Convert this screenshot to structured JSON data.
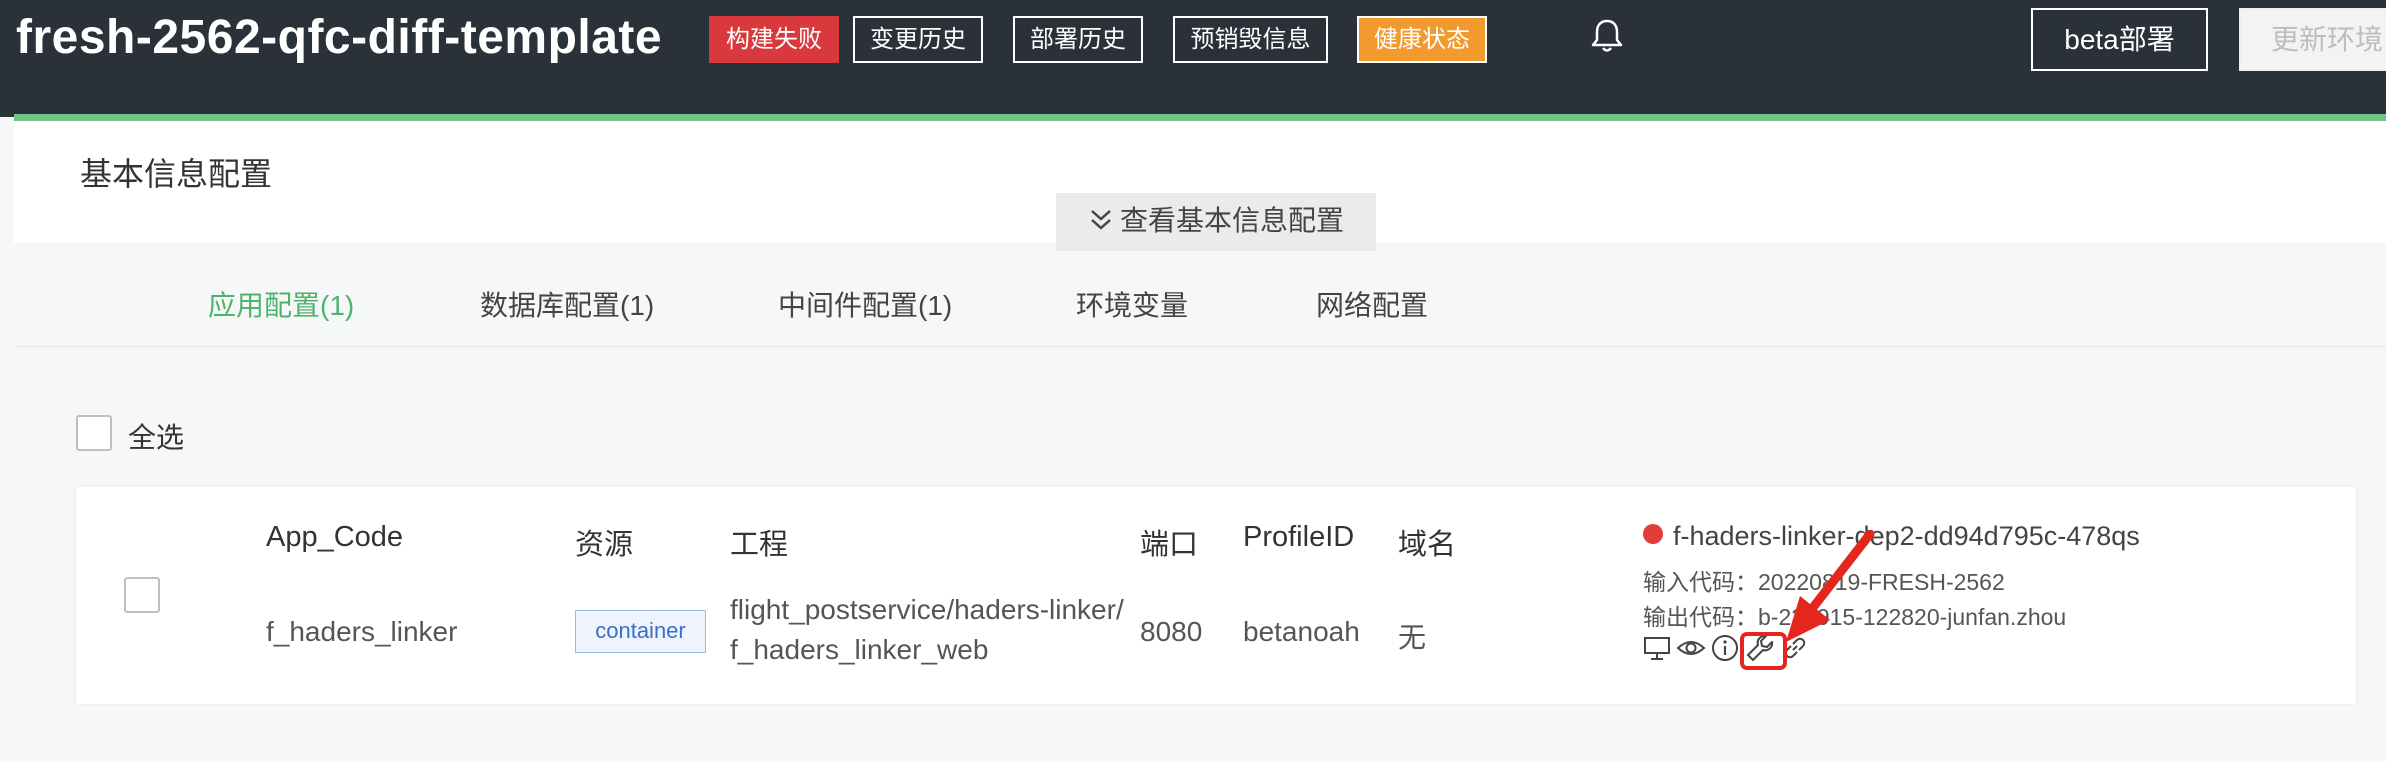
{
  "header": {
    "title": "fresh-2562-qfc-diff-template",
    "badges": {
      "build_failed": "构建失败",
      "change_history": "变更历史",
      "deploy_history": "部署历史",
      "predestroy_info": "预销毁信息",
      "health_status": "健康状态"
    },
    "bell_icon": "bell-icon",
    "beta_deploy": "beta部署",
    "update_env": "更新环境"
  },
  "basic_info": {
    "label": "基本信息配置",
    "toggle_label": "查看基本信息配置"
  },
  "tabs": [
    "应用配置(1)",
    "数据库配置(1)",
    "中间件配置(1)",
    "环境变量",
    "网络配置"
  ],
  "select_all_label": "全选",
  "table": {
    "headers": {
      "app_code": "App_Code",
      "resource": "资源",
      "project": "工程",
      "port": "端口",
      "profile": "ProfileID",
      "domain": "域名"
    },
    "row": {
      "app_code": "f_haders_linker",
      "resource": "container",
      "project_line1": "flight_postservice/haders-linker/",
      "project_line2": "f_haders_linker_web",
      "port": "8080",
      "profile": "betanoah",
      "domain": "无",
      "pod_name": "f-haders-linker-dep2-dd94d795c-478qs",
      "input_code": "输入代码：20220819-FRESH-2562",
      "output_code": "输出代码：b-220915-122820-junfan.zhou",
      "action_icons": [
        "monitor-icon",
        "eye-icon",
        "info-icon",
        "wrench-icon",
        "link-icon"
      ]
    }
  },
  "colors": {
    "header_bg": "#2b3138",
    "accent_green": "#4fb36b",
    "badge_red": "#d9393c",
    "badge_orange": "#f39a2f",
    "status_red": "#e43b3b",
    "highlight_red": "#e5261f"
  }
}
